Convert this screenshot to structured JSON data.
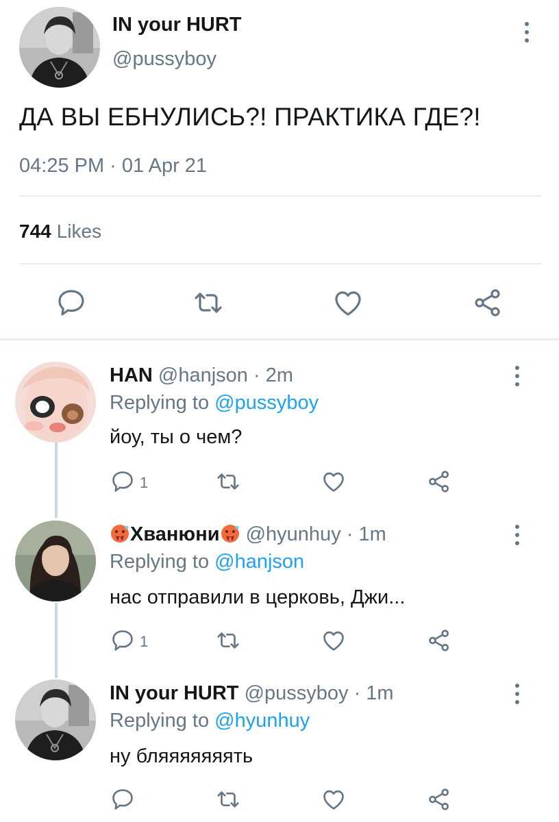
{
  "main_tweet": {
    "name": "IN your HURT",
    "handle": "@pussyboy",
    "text": "ДА ВЫ ЕБНУЛИСЬ?! ПРАКТИКА ГДЕ?!",
    "timestamp": "04:25 PM · 01 Apr 21",
    "likes_count": "744",
    "likes_label": "Likes"
  },
  "replies": [
    {
      "name": "HAN",
      "handle": "@hanjson",
      "time": "· 2m",
      "replying_label": "Replying to",
      "replying_to": "@pussyboy",
      "text": "йоу, ты о чем?",
      "reply_count": "1"
    },
    {
      "name": "Хванюни",
      "name_emoji": "hot-face",
      "handle": "@hyunhuy",
      "time": "· 1m",
      "replying_label": "Replying to",
      "replying_to": "@hanjson",
      "text": "нас отправили в церковь, Джи...",
      "reply_count": "1"
    },
    {
      "name": "IN your HURT",
      "handle": "@pussyboy",
      "time": "· 1m",
      "replying_label": "Replying to",
      "replying_to": "@hyunhuy",
      "text": "ну бляяяяяяять",
      "reply_count": ""
    }
  ],
  "colors": {
    "text_primary": "#14171a",
    "text_secondary": "#657786",
    "link": "#1da1f2",
    "divider": "#e6ecf0"
  }
}
